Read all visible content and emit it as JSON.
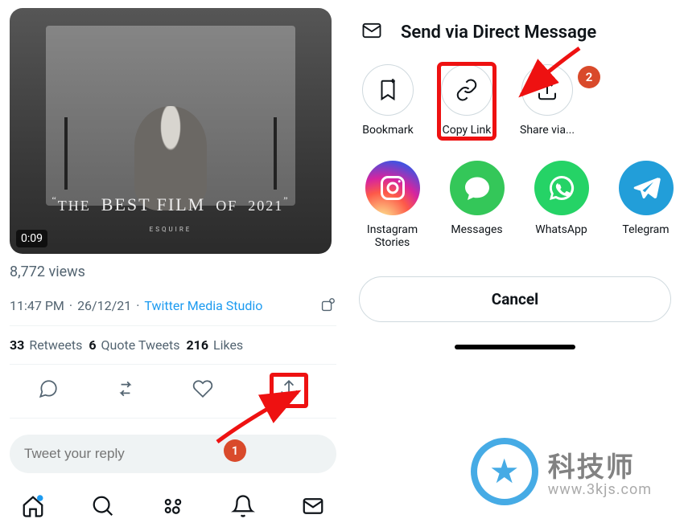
{
  "left": {
    "video": {
      "title_line": "“THE BEST FILM OF 2021”",
      "subtitle": "ESQUIRE",
      "duration": "0:09"
    },
    "views": "8,772 views",
    "time": "11:47 PM",
    "date": "26/12/21",
    "source": "Twitter Media Studio",
    "stats": {
      "retweets_n": "33",
      "retweets_l": "Retweets",
      "quotes_n": "6",
      "quotes_l": "Quote Tweets",
      "likes_n": "216",
      "likes_l": "Likes"
    },
    "reply_placeholder": "Tweet your reply"
  },
  "right": {
    "dm_label": "Send via Direct Message",
    "options": {
      "bookmark": "Bookmark",
      "copylink": "Copy Link",
      "sharevia": "Share via..."
    },
    "apps": {
      "instagram": "Instagram Stories",
      "messages": "Messages",
      "whatsapp": "WhatsApp",
      "telegram": "Telegram"
    },
    "cancel": "Cancel"
  },
  "annotations": {
    "badge1": "1",
    "badge2": "2"
  },
  "watermark": {
    "line1": "科技师",
    "line2": "www.3kjs.com"
  }
}
